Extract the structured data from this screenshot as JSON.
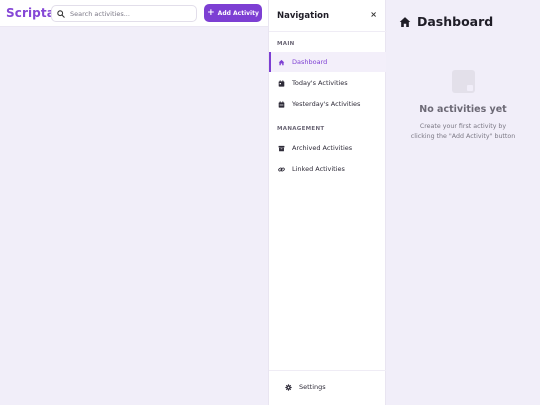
{
  "app": {
    "logo": "Scripta"
  },
  "header": {
    "search_placeholder": "Search activities...",
    "add_button_label": "Add Activity",
    "accent_color": "#7d3fd3"
  },
  "nav": {
    "title": "Navigation",
    "close_symbol": "×",
    "sections": [
      {
        "label": "MAIN",
        "items": [
          {
            "label": "Dashboard",
            "icon": "home-icon",
            "active": true
          },
          {
            "label": "Today's Activities",
            "icon": "calendar-icon",
            "active": false
          },
          {
            "label": "Yesterday's Activities",
            "icon": "calendar-icon",
            "active": false
          }
        ]
      },
      {
        "label": "MANAGEMENT",
        "items": [
          {
            "label": "Archived Activities",
            "icon": "archive-icon",
            "active": false
          },
          {
            "label": "Linked Activities",
            "icon": "link-icon",
            "active": false
          }
        ]
      }
    ],
    "settings_label": "Settings"
  },
  "main": {
    "title": "Dashboard",
    "empty_title": "No activities yet",
    "empty_line1": "Create your first activity by",
    "empty_line2": "clicking the \"Add Activity\" button"
  }
}
